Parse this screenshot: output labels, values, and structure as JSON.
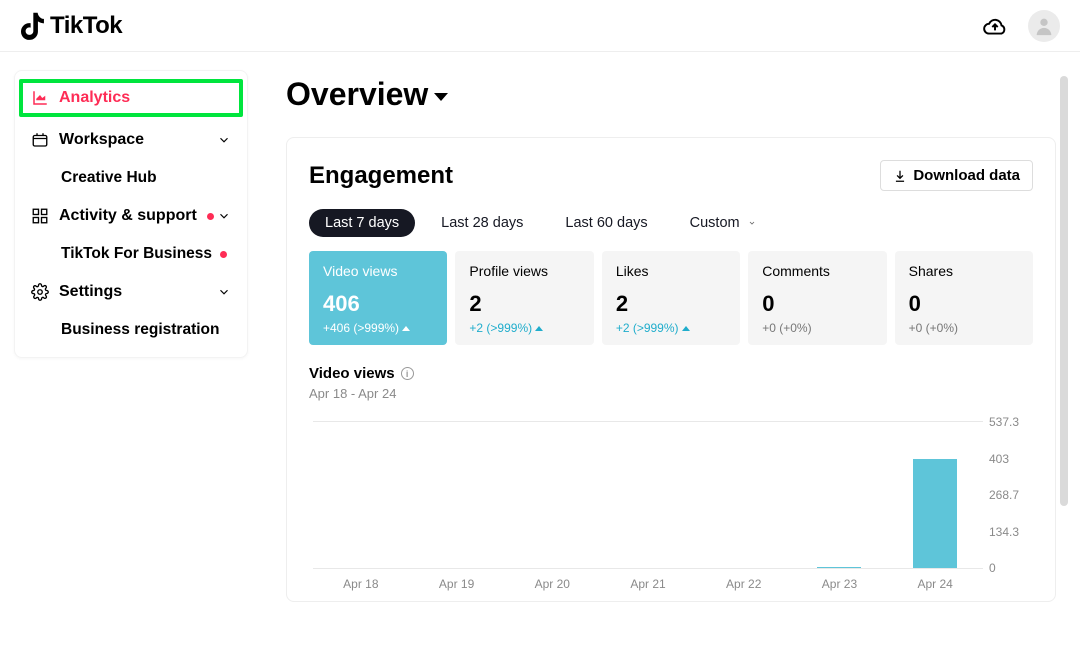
{
  "header": {
    "brand": "TikTok"
  },
  "sidebar": {
    "items": [
      {
        "label": "Analytics",
        "active": true
      },
      {
        "label": "Workspace"
      },
      {
        "label": "Creative Hub"
      },
      {
        "label": "Activity & support"
      },
      {
        "label": "TikTok For Business"
      },
      {
        "label": "Settings"
      },
      {
        "label": "Business registration"
      }
    ]
  },
  "page": {
    "title": "Overview"
  },
  "engagement": {
    "title": "Engagement",
    "download_label": "Download data",
    "ranges": [
      "Last 7 days",
      "Last 28 days",
      "Last 60 days",
      "Custom"
    ],
    "metrics": [
      {
        "label": "Video views",
        "value": "406",
        "change": "+406 (>999%)",
        "up": true,
        "active": true
      },
      {
        "label": "Profile views",
        "value": "2",
        "change": "+2 (>999%)",
        "up": true
      },
      {
        "label": "Likes",
        "value": "2",
        "change": "+2 (>999%)",
        "up": true
      },
      {
        "label": "Comments",
        "value": "0",
        "change": "+0 (+0%)",
        "up": false
      },
      {
        "label": "Shares",
        "value": "0",
        "change": "+0 (+0%)",
        "up": false
      }
    ],
    "chart_title": "Video views",
    "chart_subtitle": "Apr 18 - Apr 24"
  },
  "chart_data": {
    "type": "bar",
    "categories": [
      "Apr 18",
      "Apr 19",
      "Apr 20",
      "Apr 21",
      "Apr 22",
      "Apr 23",
      "Apr 24"
    ],
    "values": [
      0,
      0,
      0,
      0,
      0,
      3,
      403
    ],
    "ylabels": [
      "537.3",
      "403",
      "268.7",
      "134.3",
      "0"
    ],
    "ylim": [
      0,
      537.3
    ],
    "title": "Video views"
  }
}
